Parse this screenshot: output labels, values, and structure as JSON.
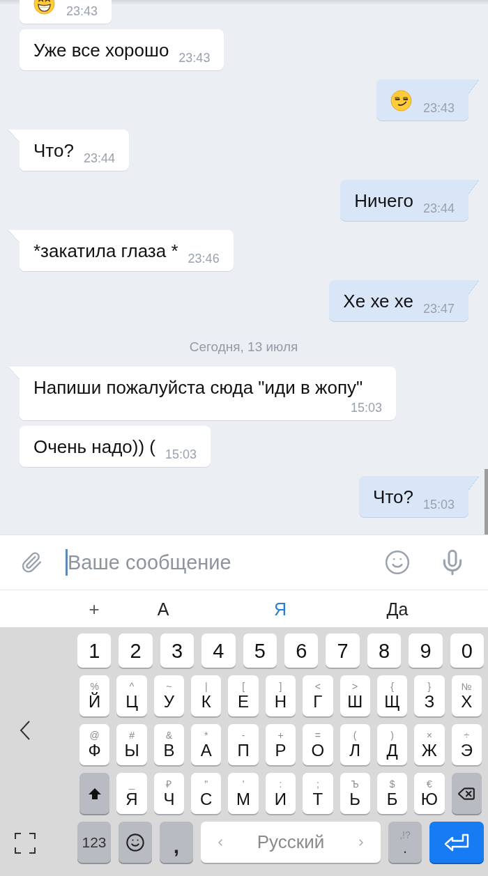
{
  "chat": {
    "messages": [
      {
        "kind": "grin",
        "outgoing": false,
        "time": "23:43",
        "tail": false
      },
      {
        "kind": "text",
        "outgoing": false,
        "text": "Уже все хорошо",
        "time": "23:43",
        "tail": false
      },
      {
        "kind": "smirk",
        "outgoing": true,
        "time": "23:43",
        "tail": true
      },
      {
        "kind": "text",
        "outgoing": false,
        "text": "Что?",
        "time": "23:44",
        "tail": true
      },
      {
        "kind": "text",
        "outgoing": true,
        "text": "Ничего",
        "time": "23:44",
        "tail": true
      },
      {
        "kind": "text",
        "outgoing": false,
        "text": "*закатила глаза *",
        "time": "23:46",
        "tail": true
      },
      {
        "kind": "text",
        "outgoing": true,
        "text": "Хе хе хе",
        "time": "23:47",
        "tail": true
      },
      {
        "kind": "date",
        "text": "Сегодня, 13 июля"
      },
      {
        "kind": "text",
        "outgoing": false,
        "text": "Напиши пожалуйста сюда \"иди в жопу\"",
        "time": "15:03",
        "tail": true
      },
      {
        "kind": "text",
        "outgoing": false,
        "text": "Очень надо)) (",
        "time": "15:03",
        "tail": false
      },
      {
        "kind": "text",
        "outgoing": true,
        "text": "Что?",
        "time": "15:03",
        "tail": true
      }
    ]
  },
  "composer": {
    "placeholder": "Ваше сообщение"
  },
  "suggestion_bar": {
    "add_label": "+",
    "words": [
      {
        "label": "А",
        "selected": false
      },
      {
        "label": "Я",
        "selected": true
      },
      {
        "label": "Да",
        "selected": false
      }
    ]
  },
  "keyboard": {
    "rows": [
      {
        "keys": [
          {
            "kind": "digit",
            "label": "1"
          },
          {
            "kind": "digit",
            "label": "2"
          },
          {
            "kind": "digit",
            "label": "3"
          },
          {
            "kind": "digit",
            "label": "4"
          },
          {
            "kind": "digit",
            "label": "5"
          },
          {
            "kind": "digit",
            "label": "6"
          },
          {
            "kind": "digit",
            "label": "7"
          },
          {
            "kind": "digit",
            "label": "8"
          },
          {
            "kind": "digit",
            "label": "9"
          },
          {
            "kind": "digit",
            "label": "0"
          }
        ]
      },
      {
        "keys": [
          {
            "kind": "letter",
            "label": "Й",
            "hint": "%"
          },
          {
            "kind": "letter",
            "label": "Ц",
            "hint": "^"
          },
          {
            "kind": "letter",
            "label": "У",
            "hint": "~"
          },
          {
            "kind": "letter",
            "label": "К",
            "hint": "|"
          },
          {
            "kind": "letter",
            "label": "Е",
            "hint": "["
          },
          {
            "kind": "letter",
            "label": "Н",
            "hint": "]"
          },
          {
            "kind": "letter",
            "label": "Г",
            "hint": "<"
          },
          {
            "kind": "letter",
            "label": "Ш",
            "hint": ">"
          },
          {
            "kind": "letter",
            "label": "Щ",
            "hint": "{"
          },
          {
            "kind": "letter",
            "label": "З",
            "hint": "}"
          },
          {
            "kind": "letter",
            "label": "Х",
            "hint": "№"
          }
        ]
      },
      {
        "keys": [
          {
            "kind": "letter",
            "label": "Ф",
            "hint": "@"
          },
          {
            "kind": "letter",
            "label": "Ы",
            "hint": "#"
          },
          {
            "kind": "letter",
            "label": "В",
            "hint": "&"
          },
          {
            "kind": "letter",
            "label": "А",
            "hint": "*"
          },
          {
            "kind": "letter",
            "label": "П",
            "hint": "-"
          },
          {
            "kind": "letter",
            "label": "Р",
            "hint": "+"
          },
          {
            "kind": "letter",
            "label": "О",
            "hint": "="
          },
          {
            "kind": "letter",
            "label": "Л",
            "hint": "("
          },
          {
            "kind": "letter",
            "label": "Д",
            "hint": ")"
          },
          {
            "kind": "letter",
            "label": "Ж",
            "hint": "×"
          },
          {
            "kind": "letter",
            "label": "Э",
            "hint": "÷"
          }
        ]
      },
      {
        "keys": [
          {
            "kind": "shift"
          },
          {
            "kind": "letter",
            "label": "Я",
            "hint": "_"
          },
          {
            "kind": "letter",
            "label": "Ч",
            "hint": "₽"
          },
          {
            "kind": "letter",
            "label": "С",
            "hint": "\""
          },
          {
            "kind": "letter",
            "label": "М",
            "hint": "'"
          },
          {
            "kind": "letter",
            "label": "И",
            "hint": ":"
          },
          {
            "kind": "letter",
            "label": "Т",
            "hint": ";"
          },
          {
            "kind": "letter",
            "label": "Ь",
            "hint": "Ъ"
          },
          {
            "kind": "letter",
            "label": "Б",
            "hint": "$"
          },
          {
            "kind": "letter",
            "label": "Ю",
            "hint": "€"
          },
          {
            "kind": "backspace"
          }
        ]
      },
      {
        "keys": [
          {
            "kind": "mode",
            "label": "123"
          },
          {
            "kind": "emoji"
          },
          {
            "kind": "comma",
            "label": ","
          },
          {
            "kind": "space",
            "label": "Русский"
          },
          {
            "kind": "period",
            "label": ".",
            "hint": ",!?"
          },
          {
            "kind": "enter"
          }
        ]
      }
    ]
  }
}
